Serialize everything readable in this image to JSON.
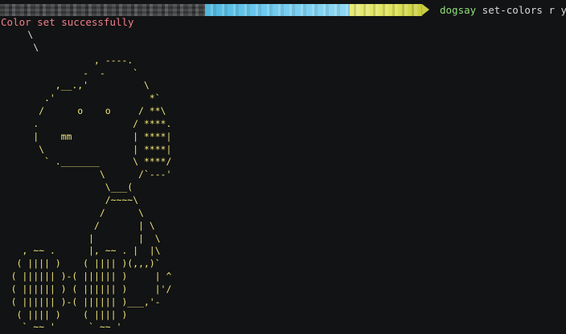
{
  "terminal": {
    "prompt": {
      "path_segment_color": "#4a4b4e",
      "git_segment_color": "#6cc9ee",
      "status_segment_color": "#dde25a"
    },
    "command": {
      "name": "dogsay",
      "args": " set-colors r y"
    },
    "output_line": "Color set successfully",
    "colors": {
      "background": "#121314",
      "command_name": "#8fe07b",
      "output_text": "#f07f8a",
      "art": "#f2e97c"
    },
    "bubble_tail": "     \\\n      \\",
    "ascii_art": "\n\n                 , ----.\n               -  -     `\n          ,__.,'          \\\n        .'                 *`\n       /      o    o     / **\\\n      .                 / ****.\n      |    mm           | ****|\n       \\                | ****|\n        ` ._______      \\ ****/\n                  \\      /`---'\n                   \\___(\n                   /~~~~\\\n                  /      \\\n                 /       | \\\n                |        |  \\\n    , ~~ .      |, ~~ . |  |\\\n   ( |||| )    ( |||| )(,,,)`\n  ( |||||| )-( |||||| )     | ^\n  ( |||||| ) ( |||||| )     |'/\n  ( |||||| )-( |||||| )___,'-\n   ( |||| )    ( |||| )\n    ` ~~ '      ` ~~ '"
  }
}
